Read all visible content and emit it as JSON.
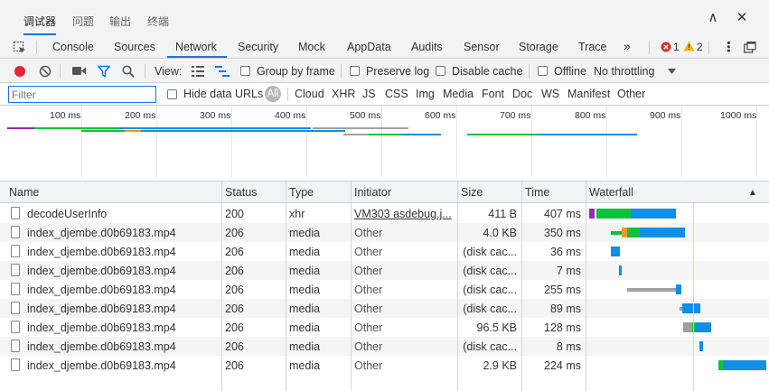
{
  "panel": {
    "tabs": [
      "调试器",
      "问题",
      "输出",
      "终端"
    ],
    "active_tab": 0,
    "chevron_up": "∧",
    "close": "✕"
  },
  "devtools": {
    "tabs": [
      "Console",
      "Sources",
      "Network",
      "Security",
      "Mock",
      "AppData",
      "Audits",
      "Sensor",
      "Storage",
      "Trace"
    ],
    "active_tab": "Network",
    "more": "»",
    "errors": "1",
    "warnings": "2",
    "kebab": "⋮"
  },
  "toolbar": {
    "view_label": "View:",
    "group_by_frame": "Group by frame",
    "preserve_log": "Preserve log",
    "disable_cache": "Disable cache",
    "offline": "Offline",
    "throttling": "No throttling"
  },
  "filter": {
    "placeholder": "Filter",
    "hide_data_urls": "Hide data URLs",
    "types": [
      "All",
      "Cloud",
      "XHR",
      "JS",
      "CSS",
      "Img",
      "Media",
      "Font",
      "Doc",
      "WS",
      "Manifest",
      "Other"
    ]
  },
  "overview": {
    "ticks": [
      "100 ms",
      "200 ms",
      "300 ms",
      "400 ms",
      "500 ms",
      "600 ms",
      "700 ms",
      "800 ms",
      "900 ms",
      "1000 ms"
    ]
  },
  "table": {
    "columns": [
      "Name",
      "Status",
      "Type",
      "Initiator",
      "Size",
      "Time",
      "Waterfall"
    ],
    "sort_indicator": "▲",
    "rows": [
      {
        "name": "decodeUserInfo",
        "status": "200",
        "type": "xhr",
        "initiator": "VM303 asdebug.j...",
        "initiator_link": true,
        "size": "411 B",
        "time": "407 ms"
      },
      {
        "name": "index_djembe.d0b69183.mp4",
        "status": "206",
        "type": "media",
        "initiator": "Other",
        "size": "4.0 KB",
        "time": "350 ms"
      },
      {
        "name": "index_djembe.d0b69183.mp4",
        "status": "206",
        "type": "media",
        "initiator": "Other",
        "size": "(disk cac...",
        "time": "36 ms"
      },
      {
        "name": "index_djembe.d0b69183.mp4",
        "status": "206",
        "type": "media",
        "initiator": "Other",
        "size": "(disk cac...",
        "time": "7 ms"
      },
      {
        "name": "index_djembe.d0b69183.mp4",
        "status": "206",
        "type": "media",
        "initiator": "Other",
        "size": "(disk cac...",
        "time": "255 ms"
      },
      {
        "name": "index_djembe.d0b69183.mp4",
        "status": "206",
        "type": "media",
        "initiator": "Other",
        "size": "(disk cac...",
        "time": "89 ms"
      },
      {
        "name": "index_djembe.d0b69183.mp4",
        "status": "206",
        "type": "media",
        "initiator": "Other",
        "size": "96.5 KB",
        "time": "128 ms"
      },
      {
        "name": "index_djembe.d0b69183.mp4",
        "status": "206",
        "type": "media",
        "initiator": "Other",
        "size": "(disk cac...",
        "time": "8 ms"
      },
      {
        "name": "index_djembe.d0b69183.mp4",
        "status": "206",
        "type": "media",
        "initiator": "Other",
        "size": "2.9 KB",
        "time": "224 ms"
      }
    ]
  },
  "colors": {
    "accent": "#1a73e8",
    "record": "#e8233a",
    "error": "#d93025",
    "warning": "#f2b600",
    "waterfall_green": "#10c23a",
    "waterfall_blue": "#0f8fe8",
    "waterfall_gray": "#a0a0a0",
    "waterfall_orange": "#f29a20"
  }
}
